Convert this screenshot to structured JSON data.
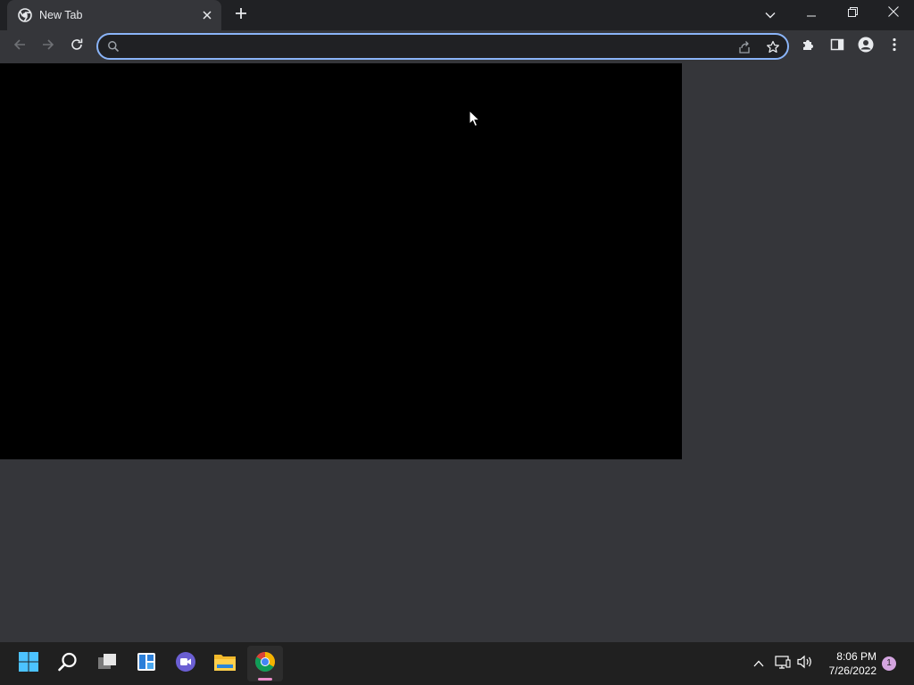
{
  "browser": {
    "tab": {
      "title": "New Tab",
      "favicon": "chrome-icon"
    },
    "window_controls": [
      "tab-search-icon",
      "minimize-icon",
      "restore-icon",
      "close-icon"
    ]
  },
  "toolbar": {
    "omnibox": {
      "value": "",
      "placeholder": ""
    },
    "icons": [
      "back-icon",
      "forward-icon",
      "reload-icon",
      "share-icon",
      "star-icon",
      "extensions-icon",
      "side-panel-icon",
      "profile-icon",
      "menu-icon"
    ]
  },
  "colors": {
    "frame": "#202124",
    "toolbar": "#35363a",
    "omnibox_focus": "#8ab4f8",
    "content_panel": "#000000",
    "taskbar": "#202020",
    "badge": "#d4a5e0"
  },
  "taskbar": {
    "apps": [
      "start-icon",
      "search-icon",
      "task-view-icon",
      "widgets-icon",
      "chat-icon",
      "file-explorer-icon",
      "chrome-icon"
    ],
    "tray_icons": [
      "show-hidden-icons-icon",
      "network-icon",
      "volume-icon"
    ],
    "clock": {
      "time": "8:06 PM",
      "date": "7/26/2022"
    },
    "notification_count": "1"
  }
}
